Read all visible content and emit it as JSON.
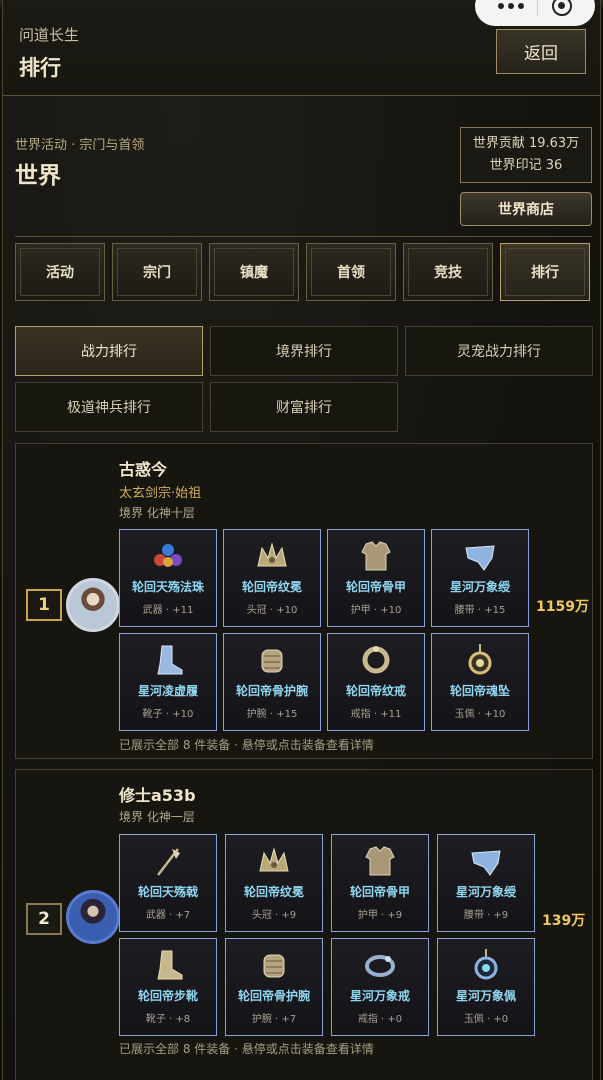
{
  "header": {
    "app_title": "问道长生",
    "page_title": "排行",
    "back_label": "返回"
  },
  "section": {
    "crumb": "世界活动 · 宗门与首领",
    "title": "世界",
    "contribution": "世界贡献 19.63万",
    "seal": "世界印记 36",
    "shop_label": "世界商店"
  },
  "tabs": [
    "活动",
    "宗门",
    "镇魔",
    "首领",
    "竞技",
    "排行"
  ],
  "active_tab": "排行",
  "subtabs": [
    "战力排行",
    "境界排行",
    "灵宠战力排行",
    "极道神兵排行",
    "财富排行"
  ],
  "active_subtab": "战力排行",
  "players": [
    {
      "rank": "1",
      "name": "古惑今",
      "sect": "太玄剑宗·始祖",
      "realm": "境界 化神十层",
      "power": "1159万",
      "note": "已展示全部 8 件装备 · 悬停或点击装备查看详情",
      "equips": [
        {
          "name": "轮回天殇法珠",
          "slot": "武器 · +11",
          "icon": "orb-icon"
        },
        {
          "name": "轮回帝纹冕",
          "slot": "头冠 · +10",
          "icon": "crown-icon"
        },
        {
          "name": "轮回帝骨甲",
          "slot": "护甲 · +10",
          "icon": "armor-icon"
        },
        {
          "name": "星河万象绶",
          "slot": "腰带 · +15",
          "icon": "belt-icon"
        },
        {
          "name": "星河凌虚履",
          "slot": "靴子 · +10",
          "icon": "boots-icon"
        },
        {
          "name": "轮回帝骨护腕",
          "slot": "护腕 · +15",
          "icon": "bracer-icon"
        },
        {
          "name": "轮回帝纹戒",
          "slot": "戒指 · +11",
          "icon": "ring-icon"
        },
        {
          "name": "轮回帝魂坠",
          "slot": "玉佩 · +10",
          "icon": "pendant-icon"
        }
      ]
    },
    {
      "rank": "2",
      "name": "修士a53b",
      "sect": "",
      "realm": "境界 化神一层",
      "power": "139万",
      "note": "已展示全部 8 件装备 · 悬停或点击装备查看详情",
      "equips": [
        {
          "name": "轮回天殇戟",
          "slot": "武器 · +7",
          "icon": "halberd-icon"
        },
        {
          "name": "轮回帝纹冕",
          "slot": "头冠 · +9",
          "icon": "crown-icon"
        },
        {
          "name": "轮回帝骨甲",
          "slot": "护甲 · +9",
          "icon": "armor-icon"
        },
        {
          "name": "星河万象绶",
          "slot": "腰带 · +9",
          "icon": "belt-icon"
        },
        {
          "name": "轮回帝步靴",
          "slot": "靴子 · +8",
          "icon": "boots-icon"
        },
        {
          "name": "轮回帝骨护腕",
          "slot": "护腕 · +7",
          "icon": "bracer-icon"
        },
        {
          "name": "星河万象戒",
          "slot": "戒指 · +0",
          "icon": "ring-icon"
        },
        {
          "name": "星河万象佩",
          "slot": "玉佩 · +0",
          "icon": "pendant-icon"
        }
      ]
    }
  ],
  "colors": {
    "accent_gold": "#f0c860",
    "equip_name": "#8fd6f0",
    "sect": "#d2ae5a"
  }
}
